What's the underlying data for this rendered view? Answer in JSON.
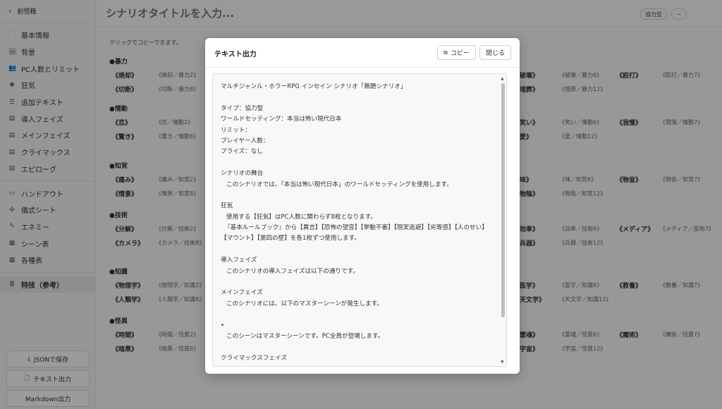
{
  "sidebar": {
    "back_label": "創怪籍",
    "items": [
      {
        "icon": "📄",
        "label": "基本情報"
      },
      {
        "icon": "🖼",
        "label": "背景"
      },
      {
        "icon": "👥",
        "label": "PC人数とリミット"
      },
      {
        "icon": "✺",
        "label": "狂気"
      },
      {
        "icon": "☰",
        "label": "追加テキスト"
      },
      {
        "icon": "▤",
        "label": "導入フェイズ"
      },
      {
        "icon": "▤",
        "label": "メインフェイズ"
      },
      {
        "icon": "▤",
        "label": "クライマックス"
      },
      {
        "icon": "▤",
        "label": "エピローグ"
      }
    ],
    "items2": [
      {
        "icon": "▭",
        "label": "ハンドアウト"
      },
      {
        "icon": "✣",
        "label": "儀式シート"
      },
      {
        "icon": "✎",
        "label": "エネミー"
      },
      {
        "icon": "▦",
        "label": "シーン表"
      },
      {
        "icon": "▦",
        "label": "各種表"
      }
    ],
    "active_item": {
      "icon": "≣",
      "label": "特技（参考）"
    },
    "buttons": {
      "json": "JSONで保存",
      "text": "テキスト出力",
      "markdown": "Markdown出力"
    }
  },
  "header": {
    "title_placeholder": "シナリオタイトルを入力...",
    "chip_type": "協力型",
    "chip_minus": "－"
  },
  "skills": {
    "hint": "クリックでコピーできます。",
    "sections": [
      "●暴力",
      "●情動",
      "●知覚",
      "●技術",
      "●知識",
      "●怪異"
    ],
    "left": [
      [
        {
          "n": "《焼却》",
          "c": "《焼却／暴力2》"
        },
        {
          "n": "《切断》",
          "c": "《切断／暴力8》"
        }
      ],
      [
        {
          "n": "《恋》",
          "c": "《恋／情動2》"
        },
        {
          "n": "《驚き》",
          "c": "《驚き／情動8》"
        }
      ],
      [
        {
          "n": "《痛み》",
          "c": "《痛み／知覚2》"
        },
        {
          "n": "《情景》",
          "c": "《情景／知覚8》"
        }
      ],
      [
        {
          "n": "《分解》",
          "c": "《分解／技術2》"
        },
        {
          "n": "《カメラ》",
          "c": "《カメラ／技術8》"
        }
      ],
      [
        {
          "n": "《物理学》",
          "c": "《物理学／知識2》"
        },
        {
          "n": "《人類学》",
          "c": "《人類学／知識8》"
        }
      ],
      [
        {
          "n": "《時間》",
          "c": "《時間／怪異2》"
        },
        {
          "n": "《暗黒》",
          "c": "《暗黒／怪異8》"
        }
      ]
    ],
    "right": [
      [
        {
          "n": "破壊》",
          "c": "《破壊／暴力6》"
        },
        {
          "n": "埋葬》",
          "c": "《埋葬／暴力12》"
        }
      ],
      [
        {
          "n": "笑い》",
          "c": "《笑い／情動6》"
        },
        {
          "n": "愛》",
          "c": "《愛／情動12》"
        }
      ],
      [
        {
          "n": "味》",
          "c": "《味／知覚6》"
        },
        {
          "n": "物陰》",
          "c": "《物陰／知覚12》"
        }
      ],
      [
        {
          "n": "効率》",
          "c": "《効率／技術6》"
        },
        {
          "n": "兵器》",
          "c": "《兵器／技術12》"
        }
      ],
      [
        {
          "n": "医学》",
          "c": "《医学／知識6》"
        },
        {
          "n": "天文学》",
          "c": "《天文学／知識12》"
        }
      ],
      [
        {
          "n": "霊魂》",
          "c": "《霊魂／怪異6》"
        },
        {
          "n": "宇宙》",
          "c": "《宇宙／怪異12》"
        }
      ]
    ],
    "far": [
      {
        "n": "《殴打》",
        "c": "《殴打／暴力7》"
      },
      {
        "n": "《我慢》",
        "c": "《我慢／情動7》"
      },
      {
        "n": "《物音》",
        "c": "《物音／知覚7》"
      },
      {
        "n": "《メディア》",
        "c": "《メディア／技術7》"
      },
      {
        "n": "《教養》",
        "c": "《教養／知識7》"
      },
      {
        "n": "《魔術》",
        "c": "《魔術／怪異7》"
      }
    ]
  },
  "modal": {
    "title": "テキスト出力",
    "copy_label": "コピー",
    "close_label": "閉じる",
    "lines": [
      {
        "t": "マルチジャンル・ホラーRPG インセイン シナリオ「無題シナリオ」",
        "cls": ""
      },
      {
        "t": "",
        "cls": ""
      },
      {
        "t": "タイプ：協力型",
        "cls": ""
      },
      {
        "t": "ワールドセッティング：本当は怖い現代日本",
        "cls": ""
      },
      {
        "t": "リミット：",
        "cls": ""
      },
      {
        "t": "プレイヤー人数：",
        "cls": ""
      },
      {
        "t": "プライズ：なし",
        "cls": ""
      },
      {
        "t": "",
        "cls": ""
      },
      {
        "t": "シナリオの舞台",
        "cls": ""
      },
      {
        "t": "このシナリオでは、「本当は怖い現代日本」のワールドセッティングを使用します。",
        "cls": "indent"
      },
      {
        "t": "",
        "cls": ""
      },
      {
        "t": "狂気",
        "cls": ""
      },
      {
        "t": "使用する【狂気】はPC人数に関わらず8枚となります。",
        "cls": "indent"
      },
      {
        "t": "『基本ルールブック』から【異言】【恐怖の望音】【挙動不審】【現実逃避】【劣等感】【人のせい】",
        "cls": "indent2"
      },
      {
        "t": "【マウント】【第四の壁】を各1枚ずつ使用します。",
        "cls": ""
      },
      {
        "t": "",
        "cls": ""
      },
      {
        "t": "導入フェイズ",
        "cls": ""
      },
      {
        "t": "このシナリオの導入フェイズは以下の通りです。",
        "cls": "indent"
      },
      {
        "t": "",
        "cls": ""
      },
      {
        "t": "メインフェイズ",
        "cls": ""
      },
      {
        "t": "このシナリオには、以下のマスターシーンが発生します。",
        "cls": "indent"
      },
      {
        "t": "",
        "cls": ""
      },
      {
        "t": "•",
        "cls": ""
      },
      {
        "t": "このシーンはマスターシーンです。PC全員が登場します。",
        "cls": "indent"
      },
      {
        "t": "",
        "cls": ""
      },
      {
        "t": "クライマックスフェイズ",
        "cls": ""
      }
    ]
  }
}
